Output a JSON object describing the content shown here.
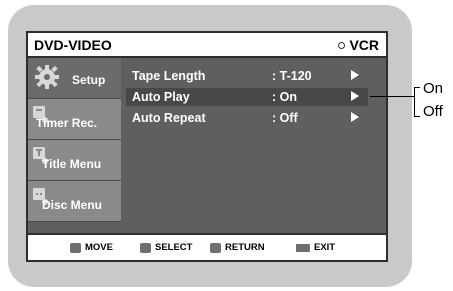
{
  "header": {
    "mode_title": "DVD-VIDEO",
    "vcr_label": "VCR"
  },
  "sidebar": {
    "items": [
      {
        "label": "Setup",
        "icon": "gear-icon",
        "active": true
      },
      {
        "label": "Timer Rec.",
        "icon": "timer-icon",
        "active": false
      },
      {
        "label": "Title Menu",
        "icon": "title-menu-icon",
        "active": false
      },
      {
        "label": "Disc Menu",
        "icon": "disc-menu-icon",
        "active": false
      }
    ]
  },
  "settings": [
    {
      "name": "Tape Length",
      "value": ": T-120",
      "highlighted": false
    },
    {
      "name": "Auto Play",
      "value": ": On",
      "highlighted": true
    },
    {
      "name": "Auto Repeat",
      "value": ": Off",
      "highlighted": false
    }
  ],
  "footer": {
    "move": "MOVE",
    "select": "SELECT",
    "return": "RETURN",
    "exit": "EXIT"
  },
  "options": [
    "On",
    "Off"
  ]
}
